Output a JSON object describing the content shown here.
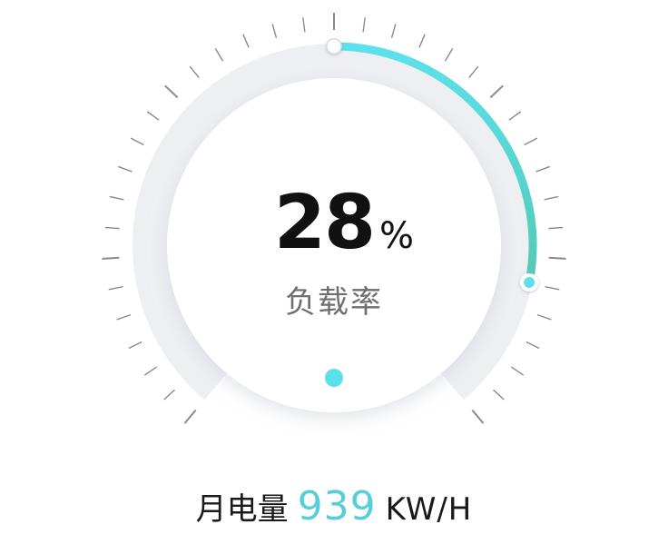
{
  "gauge": {
    "value_text": "28",
    "unit": "%",
    "label": "负载率",
    "fraction": 0.28
  },
  "summary": {
    "label": "月电量",
    "value": "939",
    "unit": "KW/H"
  },
  "colors": {
    "accent_start": "#5ce1ec",
    "accent_end": "#54c9b4",
    "track": "#eeeff3",
    "tick": "#8a8a8a",
    "indicator": "#5ce1ec"
  }
}
